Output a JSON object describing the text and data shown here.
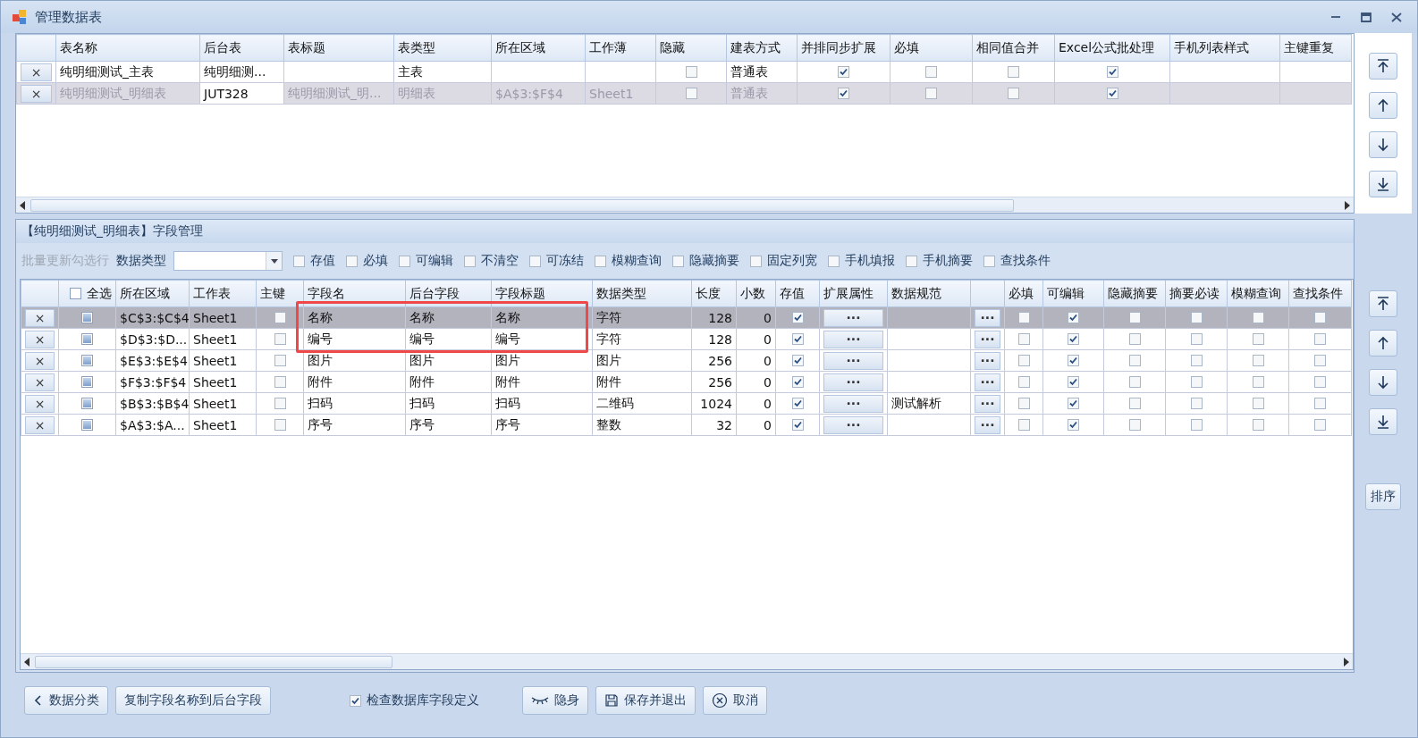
{
  "window": {
    "title": "管理数据表",
    "controls": [
      {
        "kind": "minimize"
      },
      {
        "kind": "maximize"
      },
      {
        "kind": "close"
      }
    ]
  },
  "tables_grid": {
    "columns": [
      {
        "kind": "delete"
      },
      {
        "label": "表名称",
        "kind": "text"
      },
      {
        "label": "后台表",
        "kind": "text"
      },
      {
        "label": "表标题",
        "kind": "text"
      },
      {
        "label": "表类型",
        "kind": "text"
      },
      {
        "label": "所在区域",
        "kind": "text"
      },
      {
        "label": "工作薄",
        "kind": "text"
      },
      {
        "label": "隐藏",
        "kind": "check"
      },
      {
        "label": "建表方式",
        "kind": "text"
      },
      {
        "label": "并排同步扩展",
        "kind": "check"
      },
      {
        "label": "必填",
        "kind": "check"
      },
      {
        "label": "相同值合并",
        "kind": "check"
      },
      {
        "label": "Excel公式批处理",
        "kind": "check"
      },
      {
        "label": "手机列表样式",
        "kind": "text"
      },
      {
        "label": "主键重复",
        "kind": "text"
      }
    ],
    "rows": [
      {
        "selected": false,
        "cells": [
          "×",
          "纯明细测试_主表",
          "纯明细测...",
          null,
          "主表",
          null,
          null,
          {
            "checked": false
          },
          "普通表",
          {
            "checked": true
          },
          {
            "checked": false
          },
          {
            "checked": false
          },
          {
            "checked": true
          },
          null,
          null
        ]
      },
      {
        "selected": true,
        "cells": [
          "×",
          "纯明细测试_明细表",
          {
            "text": "JUT328",
            "focused": true
          },
          "纯明细测试_明...",
          "明细表",
          "$A$3:$F$4",
          "Sheet1",
          {
            "checked": false
          },
          "普通表",
          {
            "checked": true
          },
          {
            "checked": false
          },
          {
            "checked": false
          },
          {
            "checked": true
          },
          null,
          null
        ]
      }
    ]
  },
  "side_buttons_top": [
    {
      "kind": "first"
    },
    {
      "kind": "up"
    },
    {
      "kind": "down"
    },
    {
      "kind": "last"
    }
  ],
  "fields_panel": {
    "title": "【纯明细测试_明细表】字段管理",
    "toolbar": {
      "batch_label": "批量更新勾选行",
      "batch_disabled": true,
      "type_label": "数据类型",
      "checks": [
        {
          "label": "存值",
          "checked": false
        },
        {
          "label": "必填",
          "checked": false
        },
        {
          "label": "可编辑",
          "checked": false
        },
        {
          "label": "不清空",
          "checked": false
        },
        {
          "label": "可冻结",
          "checked": false
        },
        {
          "label": "模糊查询",
          "checked": false
        },
        {
          "label": "隐藏摘要",
          "checked": false
        },
        {
          "label": "固定列宽",
          "checked": false
        },
        {
          "label": "手机填报",
          "checked": false
        },
        {
          "label": "手机摘要",
          "checked": false
        },
        {
          "label": "查找条件",
          "checked": false
        }
      ]
    },
    "columns": [
      {
        "kind": "delete"
      },
      {
        "label": "全选",
        "kind": "select",
        "checked": false
      },
      {
        "label": "所在区域",
        "kind": "text"
      },
      {
        "label": "工作表",
        "kind": "text"
      },
      {
        "label": "主键",
        "kind": "check"
      },
      {
        "label": "字段名",
        "kind": "text",
        "highlighted": true
      },
      {
        "label": "后台字段",
        "kind": "text",
        "highlighted": true
      },
      {
        "label": "字段标题",
        "kind": "text",
        "highlighted": true
      },
      {
        "label": "数据类型",
        "kind": "text"
      },
      {
        "label": "长度",
        "kind": "num"
      },
      {
        "label": "小数",
        "kind": "num"
      },
      {
        "label": "存值",
        "kind": "check"
      },
      {
        "label": "扩展属性",
        "kind": "button"
      },
      {
        "label": "数据规范",
        "kind": "text"
      },
      {
        "kind": "button"
      },
      {
        "label": "必填",
        "kind": "check"
      },
      {
        "label": "可编辑",
        "kind": "check"
      },
      {
        "label": "隐藏摘要",
        "kind": "check"
      },
      {
        "label": "摘要必读",
        "kind": "check"
      },
      {
        "label": "模糊查询",
        "kind": "check"
      },
      {
        "label": "查找条件",
        "kind": "check"
      }
    ],
    "rows": [
      {
        "selected": true,
        "highlighted": true,
        "cells": [
          "×",
          {
            "checked": false
          },
          "$C$3:$C$4",
          "Sheet1",
          {
            "checked": false
          },
          "名称",
          "名称",
          "名称",
          "字符",
          "128",
          "0",
          {
            "checked": true
          },
          "···",
          null,
          "···",
          {
            "checked": false
          },
          {
            "checked": true
          },
          {
            "checked": false
          },
          {
            "checked": false
          },
          {
            "checked": false
          },
          {
            "checked": false
          }
        ]
      },
      {
        "selected": false,
        "highlighted": true,
        "cells": [
          "×",
          {
            "checked": false
          },
          "$D$3:$D...",
          "Sheet1",
          {
            "checked": false
          },
          "编号",
          "编号",
          "编号",
          "字符",
          "128",
          "0",
          {
            "checked": true
          },
          "···",
          null,
          "···",
          {
            "checked": false
          },
          {
            "checked": true
          },
          {
            "checked": false
          },
          {
            "checked": false
          },
          {
            "checked": false
          },
          {
            "checked": false
          }
        ]
      },
      {
        "selected": false,
        "highlighted": false,
        "cells": [
          "×",
          {
            "checked": false
          },
          "$E$3:$E$4",
          "Sheet1",
          {
            "checked": false
          },
          "图片",
          "图片",
          "图片",
          "图片",
          "256",
          "0",
          {
            "checked": true
          },
          "···",
          null,
          "···",
          {
            "checked": false
          },
          {
            "checked": true
          },
          {
            "checked": false
          },
          {
            "checked": false
          },
          {
            "checked": false
          },
          {
            "checked": false
          }
        ]
      },
      {
        "selected": false,
        "highlighted": false,
        "cells": [
          "×",
          {
            "checked": false
          },
          "$F$3:$F$4",
          "Sheet1",
          {
            "checked": false
          },
          "附件",
          "附件",
          "附件",
          "附件",
          "256",
          "0",
          {
            "checked": true
          },
          "···",
          null,
          "···",
          {
            "checked": false
          },
          {
            "checked": true
          },
          {
            "checked": false
          },
          {
            "checked": false
          },
          {
            "checked": false
          },
          {
            "checked": false
          }
        ]
      },
      {
        "selected": false,
        "highlighted": false,
        "cells": [
          "×",
          {
            "checked": false
          },
          "$B$3:$B$4",
          "Sheet1",
          {
            "checked": false
          },
          "扫码",
          "扫码",
          "扫码",
          "二维码",
          "1024",
          "0",
          {
            "checked": true
          },
          "···",
          "测试解析",
          "···",
          {
            "checked": false
          },
          {
            "checked": true
          },
          {
            "checked": false
          },
          {
            "checked": false
          },
          {
            "checked": false
          },
          {
            "checked": false
          }
        ]
      },
      {
        "selected": false,
        "highlighted": false,
        "cells": [
          "×",
          {
            "checked": false
          },
          "$A$3:$A...",
          "Sheet1",
          {
            "checked": false
          },
          "序号",
          "序号",
          "序号",
          "整数",
          "32",
          "0",
          {
            "checked": true
          },
          "···",
          null,
          "···",
          {
            "checked": false
          },
          {
            "checked": true
          },
          {
            "checked": false
          },
          {
            "checked": false
          },
          {
            "checked": false
          },
          {
            "checked": false
          }
        ]
      }
    ]
  },
  "side_buttons_bottom": [
    {
      "kind": "first"
    },
    {
      "kind": "up"
    },
    {
      "kind": "down"
    },
    {
      "kind": "last"
    }
  ],
  "sort_button": {
    "label": "排序"
  },
  "footer": [
    {
      "kind": "back",
      "label": "数据分类"
    },
    {
      "kind": "plain",
      "label": "复制字段名称到后台字段"
    },
    {
      "kind": "check",
      "label": "检查数据库字段定义",
      "checked": true
    },
    {
      "kind": "hide",
      "label": "隐身"
    },
    {
      "kind": "save",
      "label": "保存并退出"
    },
    {
      "kind": "cancel",
      "label": "取消"
    }
  ]
}
